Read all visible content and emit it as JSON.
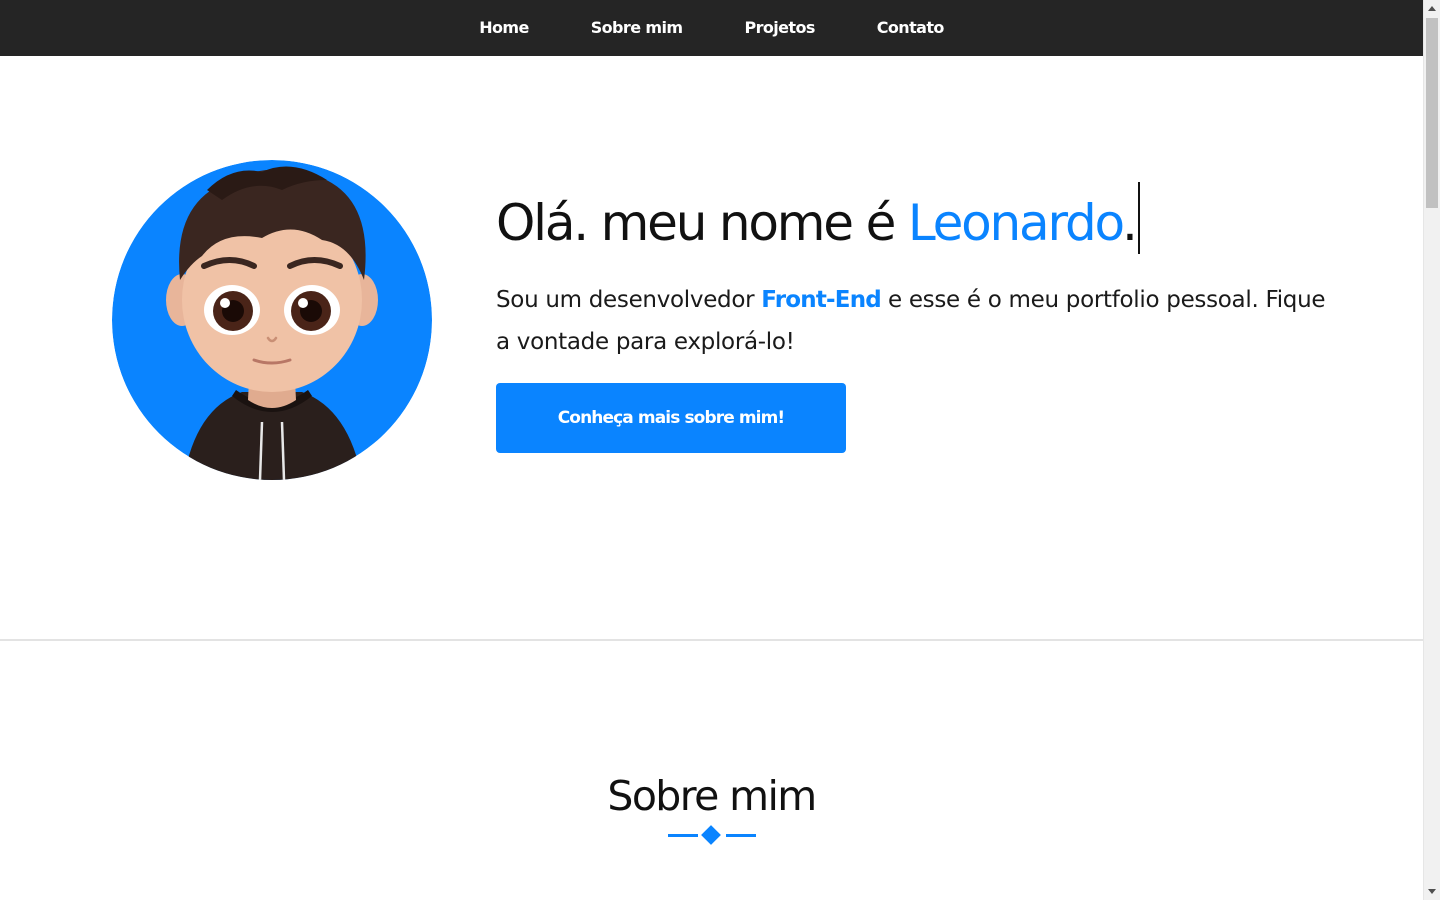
{
  "nav": {
    "items": [
      {
        "label": "Home"
      },
      {
        "label": "Sobre mim"
      },
      {
        "label": "Projetos"
      },
      {
        "label": "Contato"
      }
    ]
  },
  "hero": {
    "title_prefix": "Olá. meu nome é ",
    "name": "Leonardo",
    "title_suffix": ".",
    "text_before": "Sou um desenvolvedor ",
    "highlight": "Front-End",
    "text_after": " e esse é o meu portfolio pessoal. Fique a vontade para explorá-lo!",
    "button_label": "Conheça mais sobre mim!",
    "avatar_icon": "avatar-illustration"
  },
  "about": {
    "title": "Sobre mim"
  },
  "colors": {
    "accent": "#0a84ff",
    "nav_background": "#252525"
  }
}
